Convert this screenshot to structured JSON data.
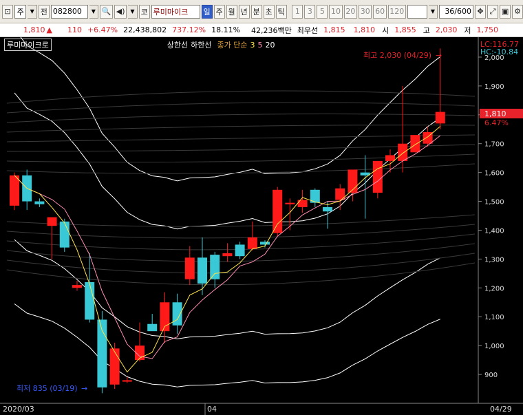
{
  "toolbar": {
    "mode_label": "주",
    "type_label": "전",
    "code_value": "082800",
    "market_label": "코",
    "stock_name": "루미마이크",
    "period_buttons": [
      "일",
      "주",
      "월",
      "년",
      "분",
      "초",
      "틱"
    ],
    "number_buttons": [
      "1",
      "3",
      "5",
      "10",
      "20",
      "30",
      "60",
      "120"
    ],
    "count_value": "36/600"
  },
  "quote": {
    "price": "1,810",
    "change": "110",
    "change_pct": "+6.47%",
    "volume": "22,438,802",
    "volume_pct": "737.12%",
    "turnover": "18.11%",
    "amount": "42,236백만",
    "best_label": "최우선",
    "best_ask": "1,815",
    "best_bid": "1,810",
    "open_label": "시",
    "open": "1,855",
    "high_label": "고",
    "high": "2,030",
    "low_label": "저",
    "low": "1,750"
  },
  "legend": {
    "title": "루미마이크로",
    "items": [
      "상한선",
      "하한선"
    ],
    "ma_label": "종가 단순",
    "ma_periods": [
      "3",
      "5",
      "20"
    ]
  },
  "annotations": {
    "high": "최고 2,030 (04/29)",
    "low": "최저 835 (03/19)",
    "lc": "LC:116.77",
    "hc": "HC:-10.84",
    "cur_price": "1,810",
    "cur_pct": "6.47%"
  },
  "x_labels": [
    "2020/03",
    "04",
    "04/29"
  ],
  "colors": {
    "up": "#ff1a1a",
    "down": "#39c9d6",
    "ma3": "#ffffff",
    "ma5": "#ff8fb0",
    "ma20": "#ffe44a",
    "bg": "#000000"
  },
  "chart_data": {
    "type": "candlestick",
    "ylim": [
      800,
      2050
    ],
    "y_ticks": [
      900,
      1000,
      1100,
      1200,
      1300,
      1400,
      1500,
      1600,
      1700,
      1800,
      1900,
      2000
    ],
    "candles": [
      {
        "o": 1485,
        "h": 1600,
        "l": 1470,
        "c": 1590
      },
      {
        "o": 1590,
        "h": 1610,
        "l": 1470,
        "c": 1500
      },
      {
        "o": 1500,
        "h": 1510,
        "l": 1480,
        "c": 1490
      },
      {
        "o": 1415,
        "h": 1430,
        "l": 1300,
        "c": 1445
      },
      {
        "o": 1430,
        "h": 1440,
        "l": 1325,
        "c": 1340
      },
      {
        "o": 1200,
        "h": 1225,
        "l": 1190,
        "c": 1210
      },
      {
        "o": 1220,
        "h": 1320,
        "l": 1080,
        "c": 1090
      },
      {
        "o": 1090,
        "h": 1120,
        "l": 835,
        "c": 855
      },
      {
        "o": 865,
        "h": 1010,
        "l": 850,
        "c": 990
      },
      {
        "o": 875,
        "h": 890,
        "l": 870,
        "c": 880
      },
      {
        "o": 950,
        "h": 1080,
        "l": 945,
        "c": 1000
      },
      {
        "o": 1075,
        "h": 1110,
        "l": 1060,
        "c": 1050
      },
      {
        "o": 1050,
        "h": 1185,
        "l": 1010,
        "c": 1150
      },
      {
        "o": 1150,
        "h": 1180,
        "l": 1040,
        "c": 1070
      },
      {
        "o": 1230,
        "h": 1345,
        "l": 1210,
        "c": 1305
      },
      {
        "o": 1305,
        "h": 1375,
        "l": 1175,
        "c": 1215
      },
      {
        "o": 1315,
        "h": 1325,
        "l": 1200,
        "c": 1230
      },
      {
        "o": 1310,
        "h": 1355,
        "l": 1290,
        "c": 1320
      },
      {
        "o": 1350,
        "h": 1360,
        "l": 1300,
        "c": 1310
      },
      {
        "o": 1335,
        "h": 1430,
        "l": 1330,
        "c": 1375
      },
      {
        "o": 1360,
        "h": 1365,
        "l": 1340,
        "c": 1350
      },
      {
        "o": 1390,
        "h": 1550,
        "l": 1380,
        "c": 1540
      },
      {
        "o": 1490,
        "h": 1510,
        "l": 1400,
        "c": 1495
      },
      {
        "o": 1480,
        "h": 1540,
        "l": 1460,
        "c": 1505
      },
      {
        "o": 1540,
        "h": 1545,
        "l": 1480,
        "c": 1495
      },
      {
        "o": 1480,
        "h": 1500,
        "l": 1405,
        "c": 1465
      },
      {
        "o": 1505,
        "h": 1560,
        "l": 1470,
        "c": 1545
      },
      {
        "o": 1530,
        "h": 1600,
        "l": 1500,
        "c": 1610
      },
      {
        "o": 1600,
        "h": 1660,
        "l": 1440,
        "c": 1590
      },
      {
        "o": 1530,
        "h": 1640,
        "l": 1510,
        "c": 1640
      },
      {
        "o": 1640,
        "h": 1680,
        "l": 1600,
        "c": 1660
      },
      {
        "o": 1640,
        "h": 1900,
        "l": 1600,
        "c": 1700
      },
      {
        "o": 1670,
        "h": 1720,
        "l": 1670,
        "c": 1730
      },
      {
        "o": 1700,
        "h": 1760,
        "l": 1690,
        "c": 1740
      },
      {
        "o": 1770,
        "h": 2030,
        "l": 1750,
        "c": 1810
      }
    ]
  }
}
